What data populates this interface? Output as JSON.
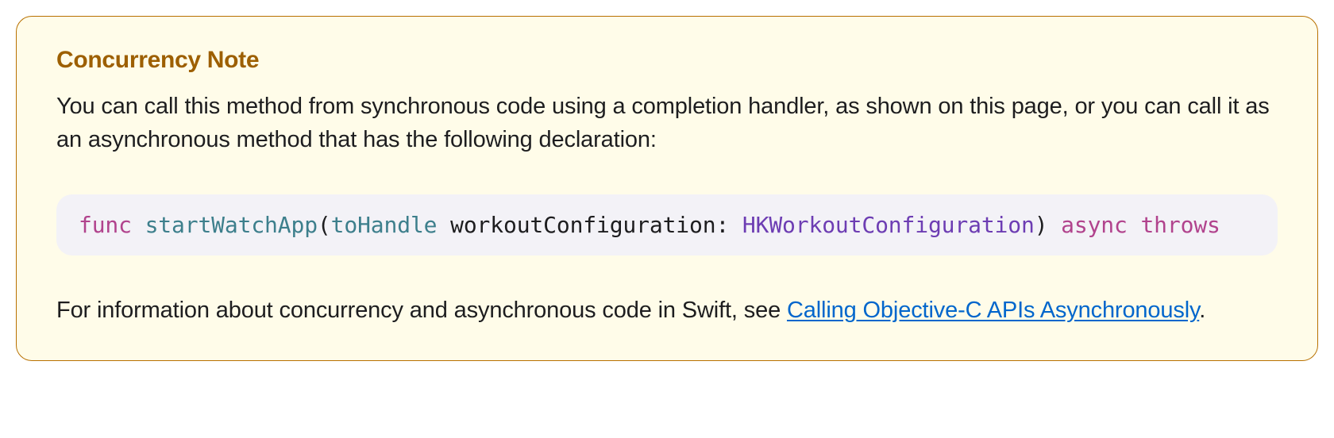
{
  "note": {
    "title": "Concurrency Note",
    "paragraph1": "You can call this method from synchronous code using a completion handler, as shown on this page, or you can call it as an asynchronous method that has the following declaration:",
    "paragraph2_pre": "For information about concurrency and asynchronous code in Swift, see ",
    "link_text": "Calling Objective-C APIs Asynchronously",
    "paragraph2_post": ".",
    "code": {
      "func_kw": "func",
      "func_name": "startWatchApp",
      "open_paren": "(",
      "arg_label": "toHandle",
      "arg_internal": " workoutConfiguration",
      "colon": ": ",
      "arg_type": "HKWorkoutConfiguration",
      "close_paren": ")",
      "async_kw": "async",
      "throws_kw": "throws"
    }
  }
}
